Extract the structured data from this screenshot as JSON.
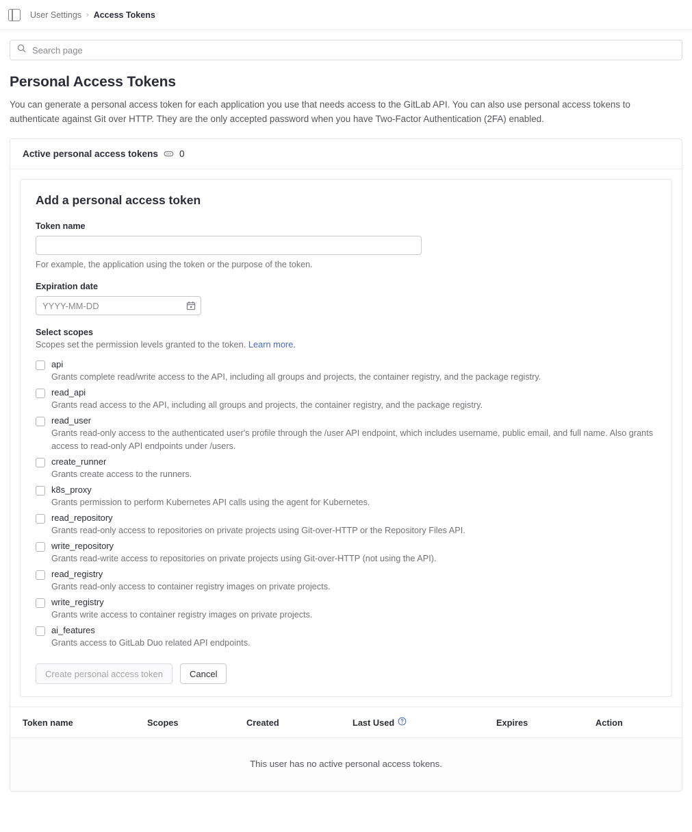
{
  "topbar": {
    "panel_toggle_icon": "sidebar-panel-icon",
    "breadcrumb": {
      "parent": "User Settings",
      "separator": "›",
      "current": "Access Tokens"
    }
  },
  "search": {
    "icon": "search-icon",
    "placeholder": "Search page",
    "value": ""
  },
  "page": {
    "title": "Personal Access Tokens",
    "description": "You can generate a personal access token for each application you use that needs access to the GitLab API. You can also use personal access tokens to authenticate against Git over HTTP. They are the only accepted password when you have Two-Factor Authentication (2FA) enabled."
  },
  "active_tokens_card": {
    "title": "Active personal access tokens",
    "badge_icon": "token-pill-icon",
    "count": "0"
  },
  "add_token_form": {
    "title": "Add a personal access token",
    "token_name": {
      "label": "Token name",
      "value": "",
      "placeholder": "",
      "help": "For example, the application using the token or the purpose of the token."
    },
    "expiration": {
      "label": "Expiration date",
      "value": "",
      "placeholder": "YYYY-MM-DD",
      "icon": "calendar-icon"
    },
    "scopes": {
      "label": "Select scopes",
      "subtitle_text": "Scopes set the permission levels granted to the token.",
      "learn_more": "Learn more.",
      "items": [
        {
          "name": "api",
          "checked": false,
          "description": "Grants complete read/write access to the API, including all groups and projects, the container registry, and the package registry."
        },
        {
          "name": "read_api",
          "checked": false,
          "description": "Grants read access to the API, including all groups and projects, the container registry, and the package registry."
        },
        {
          "name": "read_user",
          "checked": false,
          "description": "Grants read-only access to the authenticated user's profile through the /user API endpoint, which includes username, public email, and full name. Also grants access to read-only API endpoints under /users."
        },
        {
          "name": "create_runner",
          "checked": false,
          "description": "Grants create access to the runners."
        },
        {
          "name": "k8s_proxy",
          "checked": false,
          "description": "Grants permission to perform Kubernetes API calls using the agent for Kubernetes."
        },
        {
          "name": "read_repository",
          "checked": false,
          "description": "Grants read-only access to repositories on private projects using Git-over-HTTP or the Repository Files API."
        },
        {
          "name": "write_repository",
          "checked": false,
          "description": "Grants read-write access to repositories on private projects using Git-over-HTTP (not using the API)."
        },
        {
          "name": "read_registry",
          "checked": false,
          "description": "Grants read-only access to container registry images on private projects."
        },
        {
          "name": "write_registry",
          "checked": false,
          "description": "Grants write access to container registry images on private projects."
        },
        {
          "name": "ai_features",
          "checked": false,
          "description": "Grants access to GitLab Duo related API endpoints."
        }
      ]
    },
    "submit_label": "Create personal access token",
    "submit_disabled": true,
    "cancel_label": "Cancel"
  },
  "tokens_table": {
    "columns": [
      "Token name",
      "Scopes",
      "Created",
      "Last Used",
      "Expires",
      "Action"
    ],
    "last_used_help_icon": "question-circle-icon",
    "empty_message": "This user has no active personal access tokens."
  },
  "colors": {
    "link": "#486ac5",
    "text": "#2b2e39",
    "muted": "#737278",
    "border": "#e6e6e8",
    "help_icon": "#486ac5"
  }
}
